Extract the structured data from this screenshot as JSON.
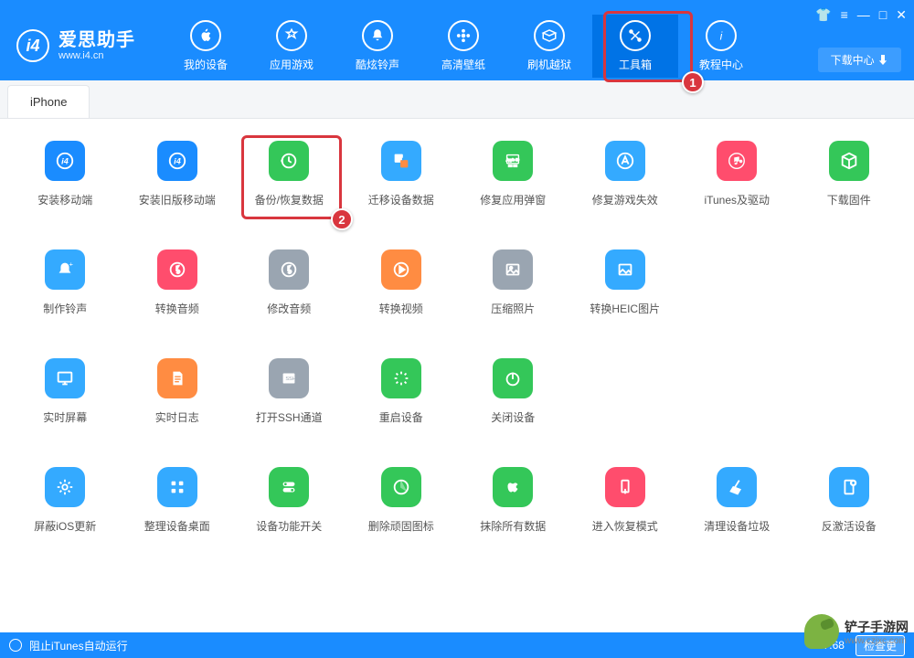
{
  "app": {
    "name_cn": "爱思助手",
    "name_en": "www.i4.cn"
  },
  "titlebar_icons": [
    "shirt",
    "menu",
    "min",
    "max",
    "close"
  ],
  "nav": [
    {
      "key": "device",
      "label": "我的设备"
    },
    {
      "key": "apps",
      "label": "应用游戏"
    },
    {
      "key": "ringtone",
      "label": "酷炫铃声"
    },
    {
      "key": "wallpaper",
      "label": "高清壁纸"
    },
    {
      "key": "flash",
      "label": "刷机越狱"
    },
    {
      "key": "toolbox",
      "label": "工具箱",
      "active": true
    },
    {
      "key": "tutorial",
      "label": "教程中心"
    }
  ],
  "download_center": "下载中心",
  "tab": "iPhone",
  "tools": [
    [
      {
        "key": "install-mobile",
        "label": "安装移动端",
        "color": "#1a8cff"
      },
      {
        "key": "install-old",
        "label": "安装旧版移动端",
        "color": "#1a8cff"
      },
      {
        "key": "backup-restore",
        "label": "备份/恢复数据",
        "color": "#34c759"
      },
      {
        "key": "migrate",
        "label": "迁移设备数据",
        "color": "#34aaff"
      },
      {
        "key": "fix-popup",
        "label": "修复应用弹窗",
        "color": "#34c759"
      },
      {
        "key": "fix-game",
        "label": "修复游戏失效",
        "color": "#34aaff"
      },
      {
        "key": "itunes-driver",
        "label": "iTunes及驱动",
        "color": "#ff4d6d"
      },
      {
        "key": "download-fw",
        "label": "下载固件",
        "color": "#34c759"
      }
    ],
    [
      {
        "key": "make-ring",
        "label": "制作铃声",
        "color": "#34aaff"
      },
      {
        "key": "convert-audio",
        "label": "转换音频",
        "color": "#ff4d6d"
      },
      {
        "key": "edit-audio",
        "label": "修改音频",
        "color": "#9aa5b1"
      },
      {
        "key": "convert-video",
        "label": "转换视频",
        "color": "#ff8c42"
      },
      {
        "key": "compress-photo",
        "label": "压缩照片",
        "color": "#9aa5b1"
      },
      {
        "key": "convert-heic",
        "label": "转换HEIC图片",
        "color": "#34aaff"
      }
    ],
    [
      {
        "key": "realtime-screen",
        "label": "实时屏幕",
        "color": "#34aaff"
      },
      {
        "key": "realtime-log",
        "label": "实时日志",
        "color": "#ff8c42"
      },
      {
        "key": "ssh",
        "label": "打开SSH通道",
        "color": "#9aa5b1"
      },
      {
        "key": "reboot",
        "label": "重启设备",
        "color": "#34c759"
      },
      {
        "key": "shutdown",
        "label": "关闭设备",
        "color": "#34c759"
      }
    ],
    [
      {
        "key": "block-update",
        "label": "屏蔽iOS更新",
        "color": "#34aaff"
      },
      {
        "key": "tidy-desktop",
        "label": "整理设备桌面",
        "color": "#34aaff"
      },
      {
        "key": "feature-switch",
        "label": "设备功能开关",
        "color": "#34c759"
      },
      {
        "key": "del-icons",
        "label": "删除顽固图标",
        "color": "#34c759"
      },
      {
        "key": "erase",
        "label": "抹除所有数据",
        "color": "#34c759"
      },
      {
        "key": "recovery",
        "label": "进入恢复模式",
        "color": "#ff4d6d"
      },
      {
        "key": "clean",
        "label": "清理设备垃圾",
        "color": "#34aaff"
      },
      {
        "key": "deactivate",
        "label": "反激活设备",
        "color": "#34aaff"
      }
    ]
  ],
  "highlights": {
    "1": "1",
    "2": "2"
  },
  "status": {
    "itunes": "阻止iTunes自动运行",
    "version": "V7.68",
    "update": "检查更"
  },
  "watermark": "铲子手游网",
  "watermark_sub": "www.czjxc.com"
}
